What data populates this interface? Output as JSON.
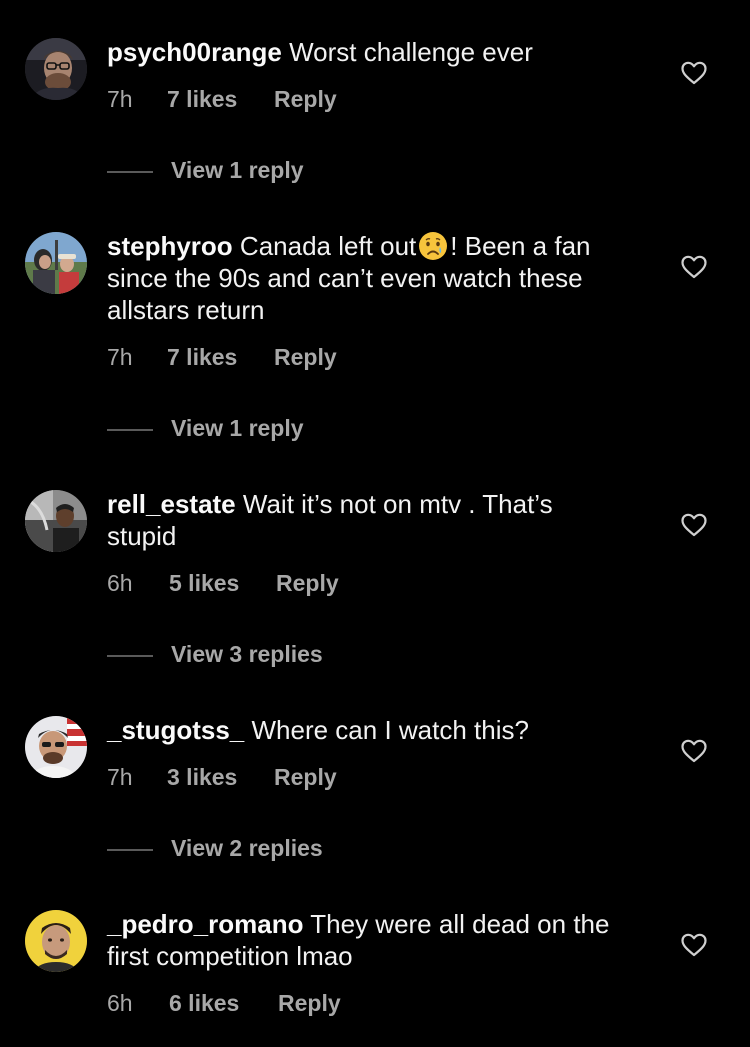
{
  "comments": [
    {
      "username": "psych00range",
      "text": "Worst challenge ever",
      "time": "7h",
      "likes": "7 likes",
      "reply": "Reply",
      "view_replies": "View 1 reply",
      "avatar": "avatar-glasses-man-icon"
    },
    {
      "username": "stephyroo",
      "text_before_emoji": "Canada left out",
      "emoji": "crying-face-emoji",
      "text_after_emoji": "! Been a fan since the 90s and can’t even watch these allstars return",
      "time": "7h",
      "likes": "7 likes",
      "reply": "Reply",
      "view_replies": "View 1 reply",
      "avatar": "avatar-outdoor-couple-icon"
    },
    {
      "username": "rell_estate",
      "text": "Wait it’s not on mtv . That’s stupid",
      "time": "6h",
      "likes": "5 likes",
      "reply": "Reply",
      "view_replies": "View 3 replies",
      "avatar": "avatar-man-car-icon"
    },
    {
      "username": "_stugotss_",
      "text": "Where can I watch this?",
      "time": "7h",
      "likes": "3 likes",
      "reply": "Reply",
      "view_replies": "View 2 replies",
      "avatar": "avatar-man-flag-icon"
    },
    {
      "username": "_pedro_romano",
      "text": "They were all dead on the first competition lmao",
      "time": "6h",
      "likes": "6 likes",
      "reply": "Reply",
      "avatar": "avatar-man-yellow-icon"
    }
  ],
  "colors": {
    "background": "#000000",
    "text": "#f2f2f2",
    "secondary": "#a8a8a8",
    "divider": "#5a5a5a"
  }
}
